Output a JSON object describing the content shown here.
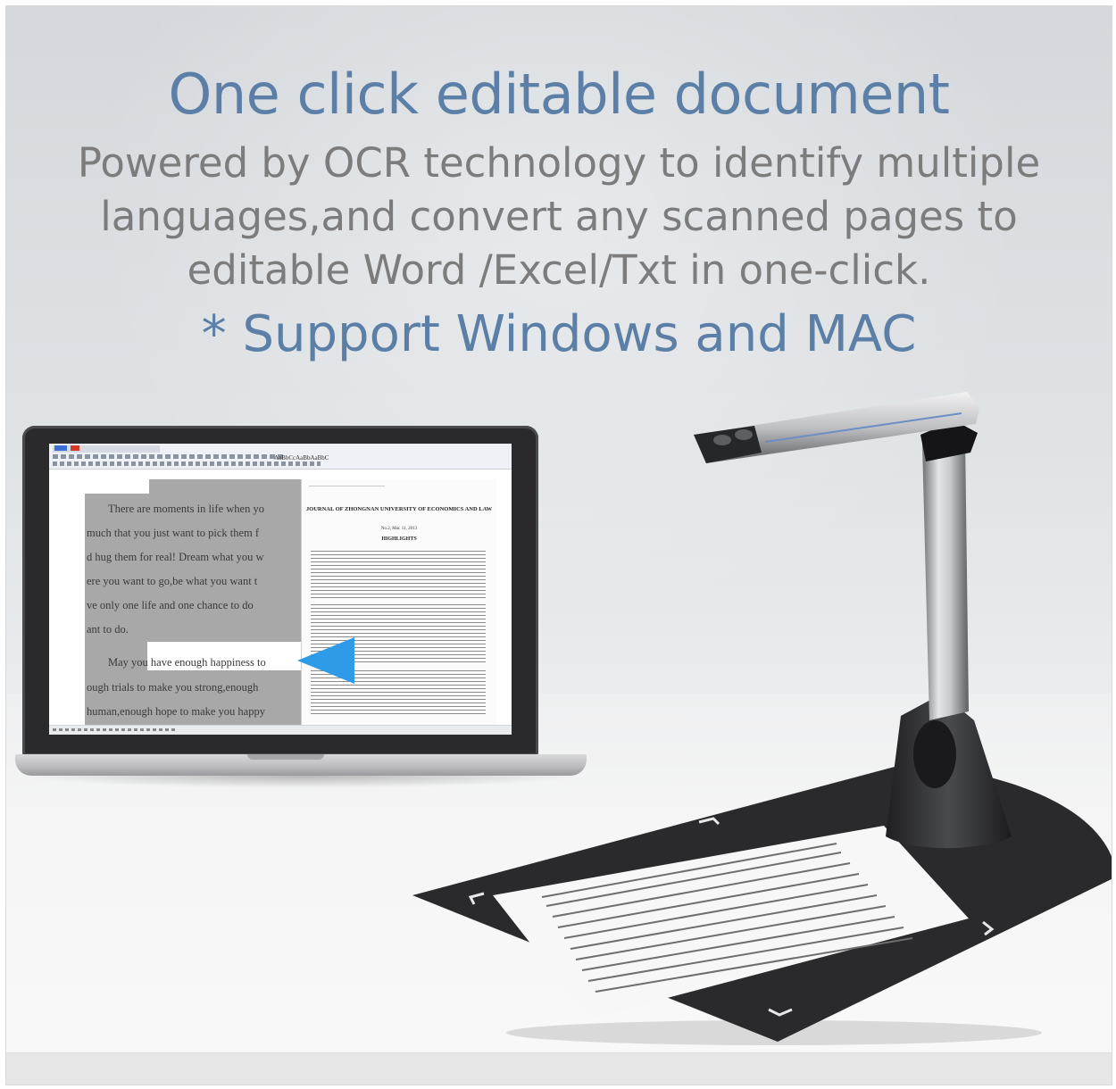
{
  "headline": "One click editable document",
  "description": "Powered by OCR technology to identify multiple languages,and convert any scanned pages to editable Word /Excel/Txt in one-click.",
  "support_note": "* Support Windows and MAC",
  "laptop_screen": {
    "toolbar_sample": "AaBbCcAaBbAaBbC",
    "document_lines": [
      "There are moments in life when yo",
      "much that you just want to pick them f",
      "d hug them for real! Dream what you w",
      "ere you want to go,be what you want t",
      "ve only one life and one chance to do",
      "ant to do.",
      "May you have enough happiness to",
      "ough trials to make you strong,enough",
      "human,enough hope to make you happy"
    ],
    "scanned_page": {
      "journal_title": "JOURNAL OF ZHONGNAN UNIVERSITY OF ECONOMICS AND LAW",
      "issue": "No.2, Mar. 11, 2013",
      "section": "HIGHLIGHTS"
    }
  },
  "colors": {
    "headline": "#5b7fa6",
    "description": "#7c7c7c",
    "arrow": "#2d9be8",
    "scanner_base": "#2b2b2d"
  },
  "icons": [
    "left-arrow-icon"
  ]
}
